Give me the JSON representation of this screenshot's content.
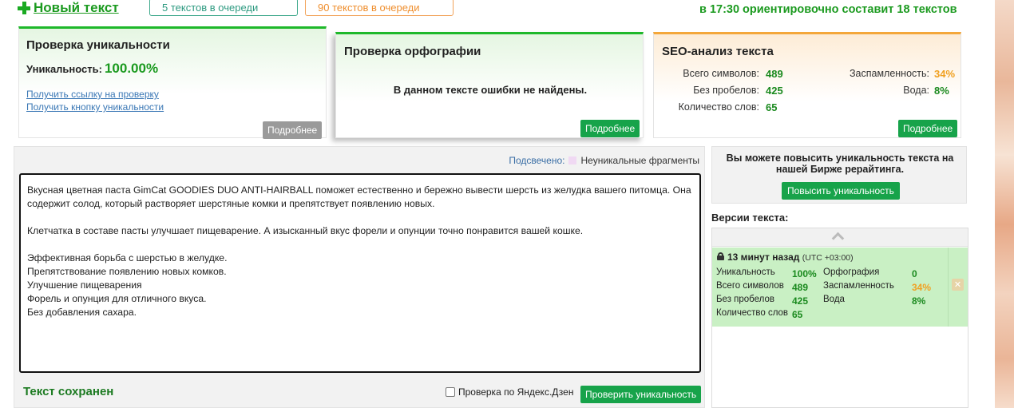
{
  "toolbar": {
    "new_text": "Новый текст",
    "queue_1": "5 текстов в очереди",
    "queue_2": "90 текстов в очереди",
    "forecast": "в 17:30 ориентировочно составит 18 текстов"
  },
  "uniqueness_card": {
    "title": "Проверка уникальности",
    "label": "Уникальность:",
    "value": "100.00%",
    "link_check": "Получить ссылку на проверку",
    "link_button": "Получить кнопку уникальности",
    "more": "Подробнее"
  },
  "spelling_card": {
    "title": "Проверка орфографии",
    "message": "В данном тексте ошибки не найдены.",
    "more": "Подробнее"
  },
  "seo_card": {
    "title": "SEO-анализ текста",
    "total_chars_label": "Всего символов:",
    "total_chars": "489",
    "no_spaces_label": "Без пробелов:",
    "no_spaces": "425",
    "words_label": "Количество слов:",
    "words": "65",
    "spam_label": "Заспамленность:",
    "spam": "34%",
    "water_label": "Вода:",
    "water": "8%",
    "more": "Подробнее"
  },
  "editor": {
    "highlight_label": "Подсвечено:",
    "highlight_legend": "Неуникальные фрагменты",
    "lines": [
      "Вкусная цветная паста GimCat GOODIES DUO ANTI-HAIRBALL поможет естественно и бережно вывести шерсть из желудка вашего питомца. Она",
      "содержит солод, который растворяет шерстяные комки и препятствует появлению новых.",
      "",
      "Клетчатка в составе пасты улучшает пищеварение. А изысканный вкус форели и опунции точно понравится вашей кошке.",
      "",
      "Эффективная борьба с шерстью в желудке.",
      "Препятствование появлению новых комков.",
      "Улучшение пищеварения",
      "Форель и опунция для отличного вкуса.",
      "Без добавления сахара."
    ],
    "saved_status": "Текст сохранен",
    "zen_checkbox": "Проверка по Яндекс.Дзен",
    "check_button": "Проверить уникальность"
  },
  "promo": {
    "text": "Вы можете повысить уникальность текста на нашей Бирже рерайтинга.",
    "button": "Повысить уникальность"
  },
  "versions": {
    "title": "Версии текста:",
    "item": {
      "time": "13 минут назад",
      "tz": "(UTC +03:00)",
      "uniq_label": "Уникальность",
      "uniq": "100%",
      "total_label": "Всего символов",
      "total": "489",
      "nospace_label": "Без пробелов",
      "nospace": "425",
      "words_label": "Количество слов",
      "words": "65",
      "spell_label": "Орфография",
      "spell": "0",
      "spam_label": "Заспамленность",
      "spam": "34%",
      "water_label": "Вода",
      "water": "8%"
    }
  },
  "colors": {
    "green": "#1b9a1f",
    "button_green": "#17a34a",
    "orange": "#ef8f2f"
  }
}
